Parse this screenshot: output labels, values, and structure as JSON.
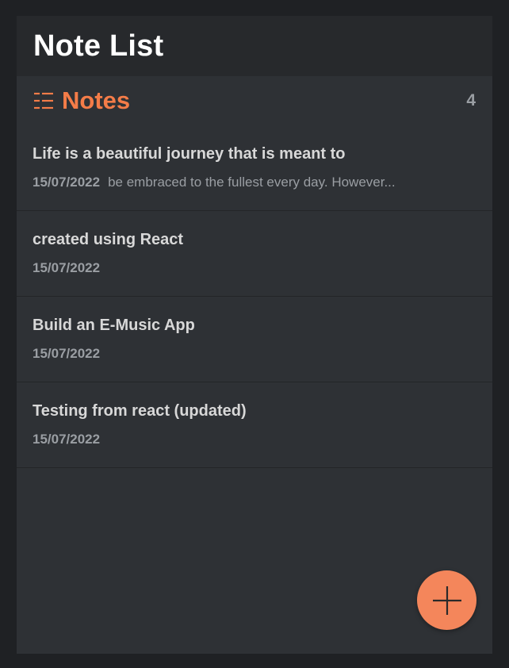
{
  "app": {
    "title": "Note List"
  },
  "notes_section": {
    "heading": "Notes",
    "count": "4",
    "icon": "list-icon"
  },
  "notes": [
    {
      "title": "Life is a beautiful journey that is meant to",
      "date": "15/07/2022",
      "preview": "be embraced to the fullest every day. However..."
    },
    {
      "title": "created using React",
      "date": "15/07/2022",
      "preview": ""
    },
    {
      "title": "Build an E-Music App",
      "date": "15/07/2022",
      "preview": ""
    },
    {
      "title": "Testing from react (updated)",
      "date": "15/07/2022",
      "preview": ""
    }
  ],
  "fab": {
    "icon": "plus-icon"
  },
  "colors": {
    "accent": "#f47c48",
    "fab": "#f4865b",
    "panel": "#2e3135",
    "header": "#27292c",
    "background": "#1f2124"
  }
}
